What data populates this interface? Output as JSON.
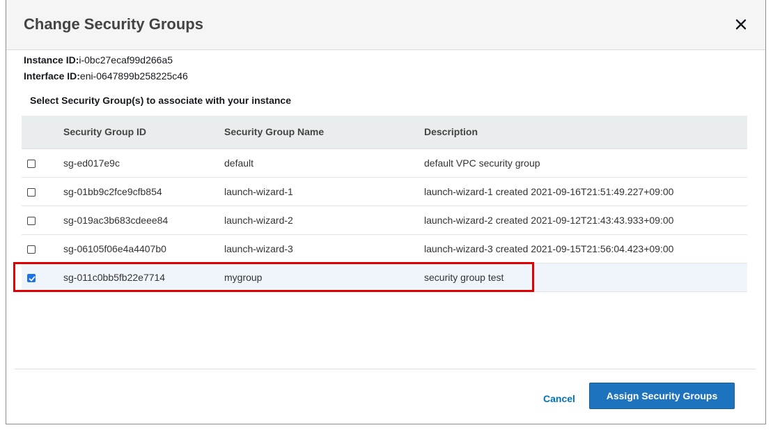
{
  "dialog": {
    "title": "Change Security Groups",
    "close_icon": "close-icon",
    "instance_label": "Instance ID:",
    "instance_value": "i-0bc27ecaf99d266a5",
    "interface_label": "Interface ID:",
    "interface_value": "eni-0647899b258225c46",
    "prompt": "Select Security Group(s) to associate with your instance"
  },
  "table": {
    "headers": [
      "Security Group ID",
      "Security Group Name",
      "Description"
    ],
    "rows": [
      {
        "id": "sg-ed017e9c",
        "name": "default",
        "description": "default VPC security group",
        "checked": false
      },
      {
        "id": "sg-01bb9c2fce9cfb854",
        "name": "launch-wizard-1",
        "description": "launch-wizard-1 created 2021-09-16T21:51:49.227+09:00",
        "checked": false
      },
      {
        "id": "sg-019ac3b683cdeee84",
        "name": "launch-wizard-2",
        "description": "launch-wizard-2 created 2021-09-12T21:43:43.933+09:00",
        "checked": false
      },
      {
        "id": "sg-06105f06e4a4407b0",
        "name": "launch-wizard-3",
        "description": "launch-wizard-3 created 2021-09-15T21:56:04.423+09:00",
        "checked": false
      },
      {
        "id": "sg-011c0bb5fb22e7714",
        "name": "mygroup",
        "description": "security group test",
        "checked": true
      }
    ]
  },
  "footer": {
    "cancel_label": "Cancel",
    "assign_label": "Assign Security Groups"
  },
  "colors": {
    "accent": "#1e73be",
    "highlight": "#e00000",
    "link": "#0073bb"
  }
}
